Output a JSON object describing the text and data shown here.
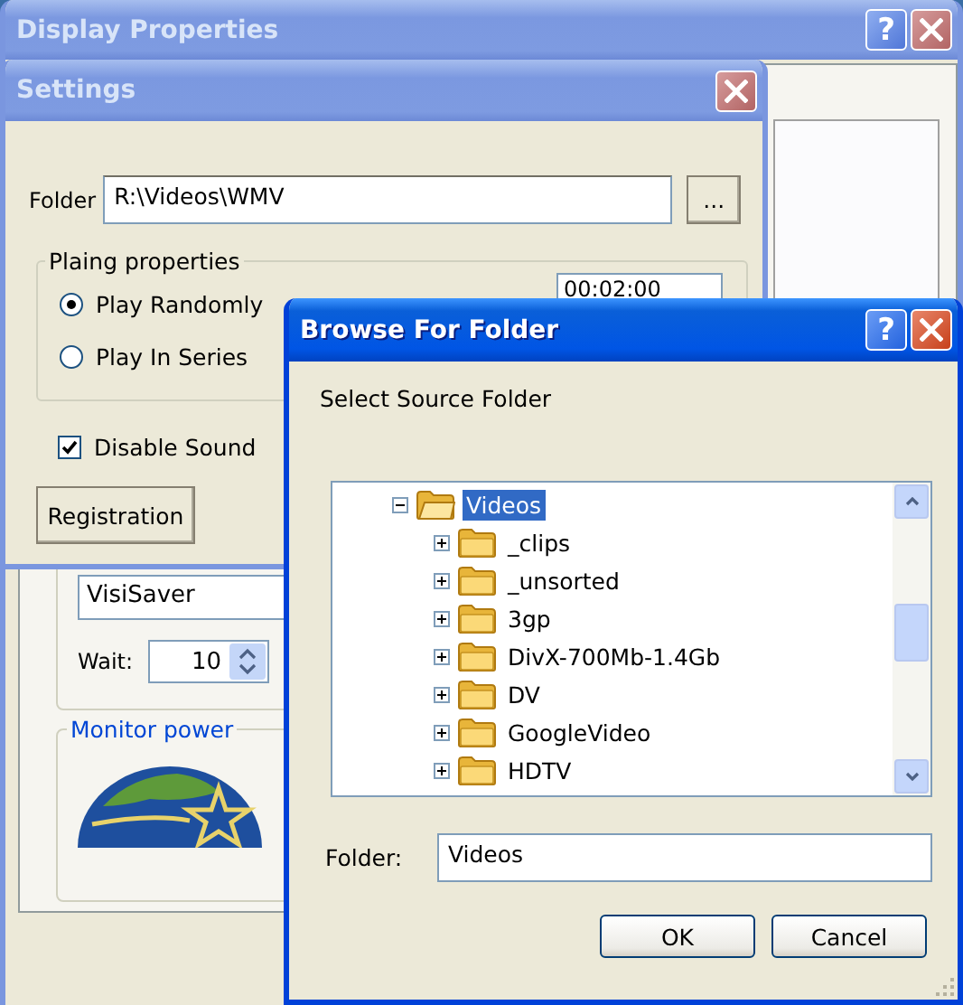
{
  "display_properties": {
    "title": "Display Properties",
    "active": false,
    "help_button": "?",
    "screen_saver": {
      "name": "VisiSaver",
      "wait_label": "Wait:",
      "wait_value": "10"
    },
    "monitor_power": {
      "title": "Monitor power"
    }
  },
  "settings": {
    "title": "Settings",
    "active": false,
    "folder_label": "Folder",
    "folder_value": "R:\\Videos\\WMV",
    "browse_button": "...",
    "group_title": "Plaing properties",
    "options": [
      {
        "label": "Play Randomly",
        "selected": true
      },
      {
        "label": "Play In Series",
        "selected": false
      }
    ],
    "time_value": "00:02:00",
    "disable_sound": {
      "label": "Disable Sound",
      "checked": true
    },
    "registration_button": "Registration"
  },
  "browse_dialog": {
    "title": "Browse For Folder",
    "active": true,
    "help_button": "?",
    "prompt": "Select Source Folder",
    "tree": [
      {
        "label": "Videos",
        "expanded": true,
        "selected": true,
        "children": [
          {
            "label": "_clips",
            "expanded": false,
            "selected": false
          },
          {
            "label": "_unsorted",
            "expanded": false,
            "selected": false
          },
          {
            "label": "3gp",
            "expanded": false,
            "selected": false
          },
          {
            "label": "DivX-700Mb-1.4Gb",
            "expanded": false,
            "selected": false
          },
          {
            "label": "DV",
            "expanded": false,
            "selected": false
          },
          {
            "label": "GoogleVideo",
            "expanded": false,
            "selected": false
          },
          {
            "label": "HDTV",
            "expanded": false,
            "selected": false
          }
        ]
      }
    ],
    "folder_label": "Folder:",
    "folder_value": "Videos",
    "buttons": [
      "OK",
      "Cancel"
    ]
  }
}
